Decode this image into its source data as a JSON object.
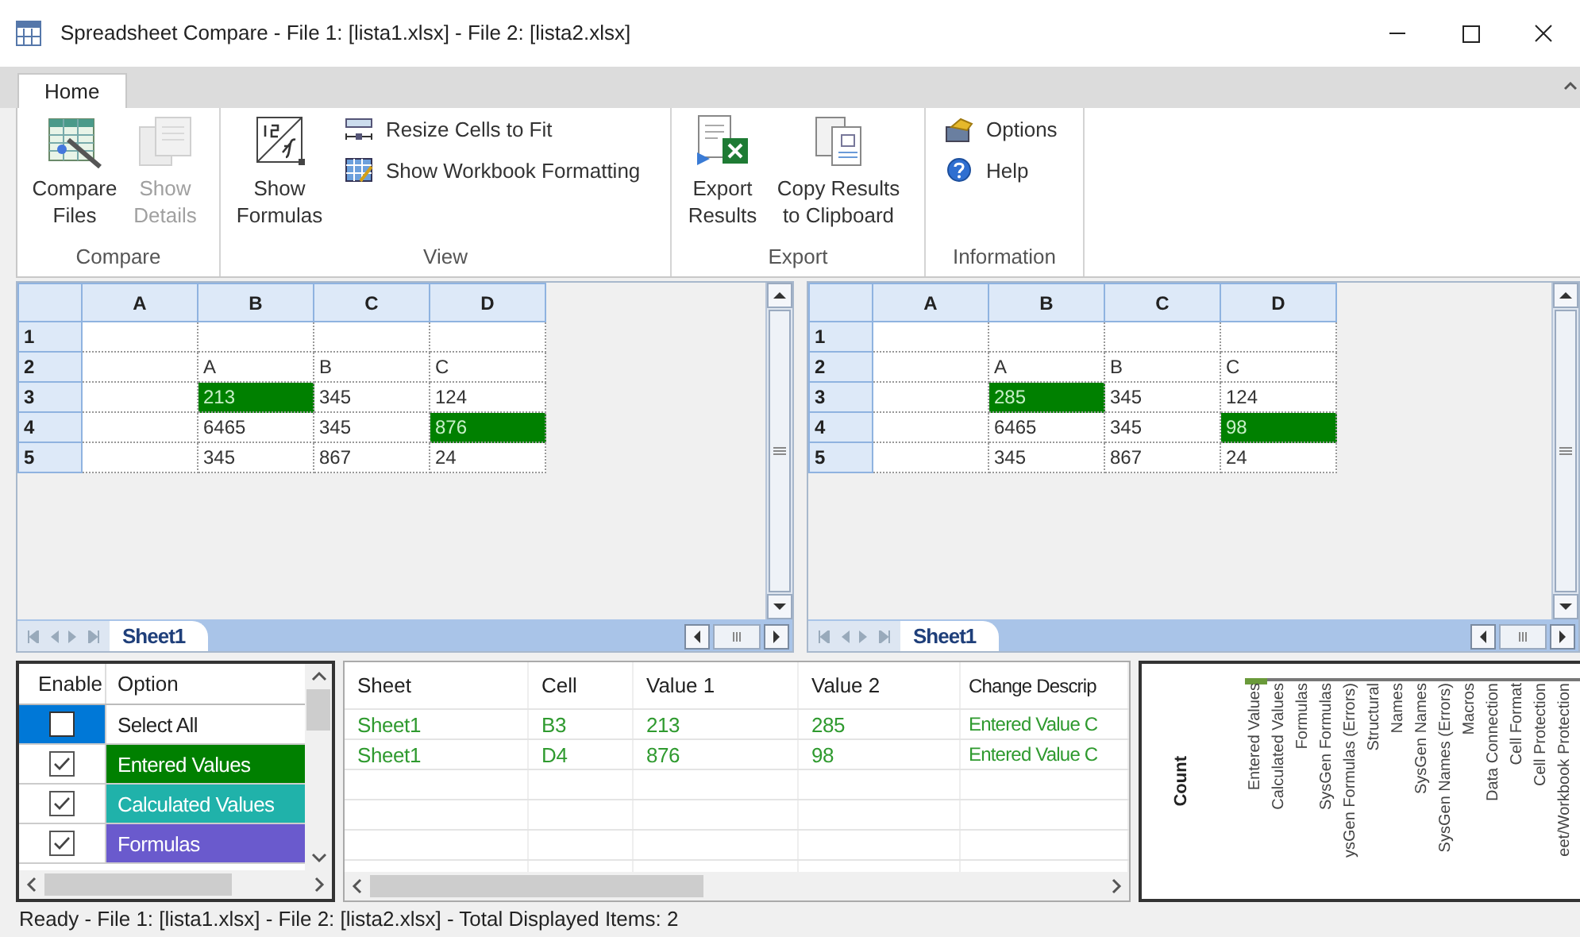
{
  "window": {
    "title": "Spreadsheet Compare - File 1: [lista1.xlsx] - File 2: [lista2.xlsx]"
  },
  "ribbon": {
    "tabs": [
      {
        "label": "Home",
        "selected": true
      }
    ],
    "groups": [
      {
        "label": "Compare",
        "items": [
          {
            "kind": "large",
            "label": "Compare Files",
            "disabled": false
          },
          {
            "kind": "large",
            "label": "Show Details",
            "disabled": true
          }
        ]
      },
      {
        "label": "View",
        "items": [
          {
            "kind": "large",
            "label": "Show Formulas",
            "disabled": false
          },
          {
            "kind": "small",
            "label": "Resize Cells to Fit",
            "disabled": false
          },
          {
            "kind": "small",
            "label": "Show Workbook Formatting",
            "disabled": false
          }
        ]
      },
      {
        "label": "Export",
        "items": [
          {
            "kind": "large",
            "label": "Export Results",
            "disabled": false
          },
          {
            "kind": "large",
            "label": "Copy Results to Clipboard",
            "disabled": false
          }
        ]
      },
      {
        "label": "Information",
        "items": [
          {
            "kind": "small",
            "label": "Options",
            "disabled": false
          },
          {
            "kind": "small",
            "label": "Help",
            "disabled": false
          }
        ]
      }
    ]
  },
  "panes": [
    {
      "columns": [
        "A",
        "B",
        "C",
        "D"
      ],
      "rows": [
        {
          "header": "1",
          "cells": [
            {
              "text": "",
              "changed": false
            },
            {
              "text": "",
              "changed": false
            },
            {
              "text": "",
              "changed": false
            },
            {
              "text": "",
              "changed": false
            }
          ]
        },
        {
          "header": "2",
          "cells": [
            {
              "text": "",
              "changed": false
            },
            {
              "text": "A",
              "changed": false
            },
            {
              "text": "B",
              "changed": false
            },
            {
              "text": "C",
              "changed": false
            }
          ]
        },
        {
          "header": "3",
          "cells": [
            {
              "text": "",
              "changed": false
            },
            {
              "text": "213",
              "changed": true
            },
            {
              "text": "345",
              "changed": false
            },
            {
              "text": "124",
              "changed": false
            }
          ]
        },
        {
          "header": "4",
          "cells": [
            {
              "text": "",
              "changed": false
            },
            {
              "text": "6465",
              "changed": false
            },
            {
              "text": "345",
              "changed": false
            },
            {
              "text": "876",
              "changed": true
            }
          ]
        },
        {
          "header": "5",
          "cells": [
            {
              "text": "",
              "changed": false
            },
            {
              "text": "345",
              "changed": false
            },
            {
              "text": "867",
              "changed": false
            },
            {
              "text": "24",
              "changed": false
            }
          ]
        }
      ],
      "sheet_tab": "Sheet1"
    },
    {
      "columns": [
        "A",
        "B",
        "C",
        "D"
      ],
      "rows": [
        {
          "header": "1",
          "cells": [
            {
              "text": "",
              "changed": false
            },
            {
              "text": "",
              "changed": false
            },
            {
              "text": "",
              "changed": false
            },
            {
              "text": "",
              "changed": false
            }
          ]
        },
        {
          "header": "2",
          "cells": [
            {
              "text": "",
              "changed": false
            },
            {
              "text": "A",
              "changed": false
            },
            {
              "text": "B",
              "changed": false
            },
            {
              "text": "C",
              "changed": false
            }
          ]
        },
        {
          "header": "3",
          "cells": [
            {
              "text": "",
              "changed": false
            },
            {
              "text": "285",
              "changed": true
            },
            {
              "text": "345",
              "changed": false
            },
            {
              "text": "124",
              "changed": false
            }
          ]
        },
        {
          "header": "4",
          "cells": [
            {
              "text": "",
              "changed": false
            },
            {
              "text": "6465",
              "changed": false
            },
            {
              "text": "345",
              "changed": false
            },
            {
              "text": "98",
              "changed": true
            }
          ]
        },
        {
          "header": "5",
          "cells": [
            {
              "text": "",
              "changed": false
            },
            {
              "text": "345",
              "changed": false
            },
            {
              "text": "867",
              "changed": false
            },
            {
              "text": "24",
              "changed": false
            }
          ]
        }
      ],
      "sheet_tab": "Sheet1"
    }
  ],
  "options": {
    "columns": [
      "Enable",
      "Option"
    ],
    "rows": [
      {
        "label": "Select All",
        "checked": false,
        "selected": true
      },
      {
        "label": "Entered Values",
        "checked": true,
        "selected": false,
        "color": "#008000"
      },
      {
        "label": "Calculated Values",
        "checked": true,
        "selected": false,
        "color": "#20b2aa"
      },
      {
        "label": "Formulas",
        "checked": true,
        "selected": false,
        "color": "#6a5acd"
      }
    ]
  },
  "results": {
    "columns": [
      "Sheet",
      "Cell",
      "Value 1",
      "Value 2",
      "Change Descrip"
    ],
    "rows": [
      [
        "Sheet1",
        "B3",
        "213",
        "285",
        "Entered Value C"
      ],
      [
        "Sheet1",
        "D4",
        "876",
        "98",
        "Entered Value C"
      ]
    ]
  },
  "chart": {
    "ylabel": "Count",
    "categories": [
      "Entered Values",
      "Calculated Values",
      "Formulas",
      "SysGen Formulas",
      "ysGen Formulas (Errors)",
      "Structural",
      "Names",
      "SysGen Names",
      "SysGen Names (Errors)",
      "Macros",
      "Data Connection",
      "Cell Format",
      "Cell Protection",
      "eet/Workbook Protection"
    ]
  },
  "status_bar": "Ready - File 1: [lista1.xlsx] - File 2: [lista2.xlsx] - Total Displayed Items: 2"
}
